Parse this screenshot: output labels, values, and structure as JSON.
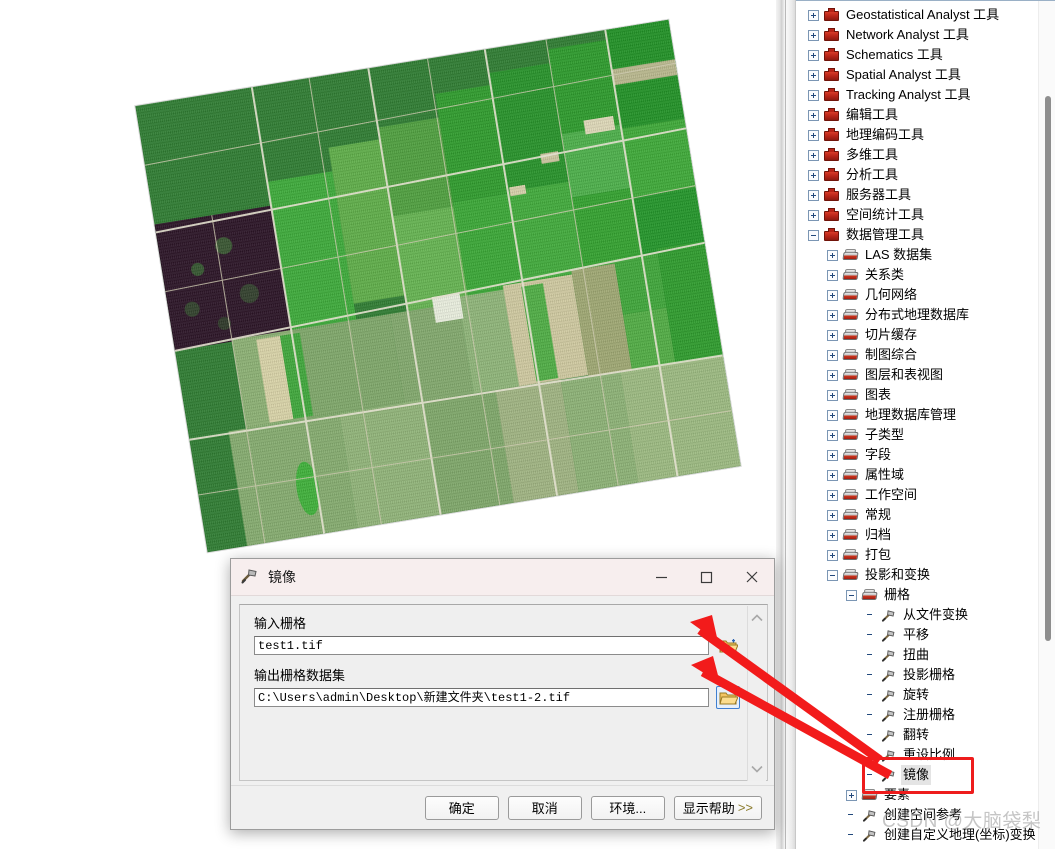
{
  "app": {
    "map_view_name": "data-view",
    "raster_description": "rotated aerial farmland raster"
  },
  "toolbox": {
    "panel_name": "ArcToolbox",
    "items": [
      {
        "label": "Geostatistical Analyst 工具",
        "level": 0,
        "icon": "toolbox-icon",
        "expander": "plus"
      },
      {
        "label": "Network Analyst 工具",
        "level": 0,
        "icon": "toolbox-icon",
        "expander": "plus"
      },
      {
        "label": "Schematics 工具",
        "level": 0,
        "icon": "toolbox-icon",
        "expander": "plus"
      },
      {
        "label": "Spatial Analyst 工具",
        "level": 0,
        "icon": "toolbox-icon",
        "expander": "plus"
      },
      {
        "label": "Tracking Analyst 工具",
        "level": 0,
        "icon": "toolbox-icon",
        "expander": "plus"
      },
      {
        "label": "编辑工具",
        "level": 0,
        "icon": "toolbox-icon",
        "expander": "plus"
      },
      {
        "label": "地理编码工具",
        "level": 0,
        "icon": "toolbox-icon",
        "expander": "plus"
      },
      {
        "label": "多维工具",
        "level": 0,
        "icon": "toolbox-icon",
        "expander": "plus"
      },
      {
        "label": "分析工具",
        "level": 0,
        "icon": "toolbox-icon",
        "expander": "plus"
      },
      {
        "label": "服务器工具",
        "level": 0,
        "icon": "toolbox-icon",
        "expander": "plus"
      },
      {
        "label": "空间统计工具",
        "level": 0,
        "icon": "toolbox-icon",
        "expander": "plus"
      },
      {
        "label": "数据管理工具",
        "level": 0,
        "icon": "toolbox-icon",
        "expander": "minus"
      },
      {
        "label": "LAS 数据集",
        "level": 1,
        "icon": "toolset-icon",
        "expander": "plus"
      },
      {
        "label": "关系类",
        "level": 1,
        "icon": "toolset-icon",
        "expander": "plus"
      },
      {
        "label": "几何网络",
        "level": 1,
        "icon": "toolset-icon",
        "expander": "plus"
      },
      {
        "label": "分布式地理数据库",
        "level": 1,
        "icon": "toolset-icon",
        "expander": "plus"
      },
      {
        "label": "切片缓存",
        "level": 1,
        "icon": "toolset-icon",
        "expander": "plus"
      },
      {
        "label": "制图综合",
        "level": 1,
        "icon": "toolset-icon",
        "expander": "plus"
      },
      {
        "label": "图层和表视图",
        "level": 1,
        "icon": "toolset-icon",
        "expander": "plus"
      },
      {
        "label": "图表",
        "level": 1,
        "icon": "toolset-icon",
        "expander": "plus"
      },
      {
        "label": "地理数据库管理",
        "level": 1,
        "icon": "toolset-icon",
        "expander": "plus"
      },
      {
        "label": "子类型",
        "level": 1,
        "icon": "toolset-icon",
        "expander": "plus"
      },
      {
        "label": "字段",
        "level": 1,
        "icon": "toolset-icon",
        "expander": "plus"
      },
      {
        "label": "属性域",
        "level": 1,
        "icon": "toolset-icon",
        "expander": "plus"
      },
      {
        "label": "工作空间",
        "level": 1,
        "icon": "toolset-icon",
        "expander": "plus"
      },
      {
        "label": "常规",
        "level": 1,
        "icon": "toolset-icon",
        "expander": "plus"
      },
      {
        "label": "归档",
        "level": 1,
        "icon": "toolset-icon",
        "expander": "plus"
      },
      {
        "label": "打包",
        "level": 1,
        "icon": "toolset-icon",
        "expander": "plus"
      },
      {
        "label": "投影和变换",
        "level": 1,
        "icon": "toolset-icon",
        "expander": "minus"
      },
      {
        "label": "栅格",
        "level": 2,
        "icon": "toolset-icon",
        "expander": "minus"
      },
      {
        "label": "从文件变换",
        "level": 3,
        "icon": "hammer-icon",
        "expander": "none"
      },
      {
        "label": "平移",
        "level": 3,
        "icon": "hammer-icon",
        "expander": "none"
      },
      {
        "label": "扭曲",
        "level": 3,
        "icon": "hammer-icon",
        "expander": "none"
      },
      {
        "label": "投影栅格",
        "level": 3,
        "icon": "hammer-icon",
        "expander": "none"
      },
      {
        "label": "旋转",
        "level": 3,
        "icon": "hammer-icon",
        "expander": "none"
      },
      {
        "label": "注册栅格",
        "level": 3,
        "icon": "hammer-icon",
        "expander": "none"
      },
      {
        "label": "翻转",
        "level": 3,
        "icon": "hammer-icon",
        "expander": "none"
      },
      {
        "label": "重设比例",
        "level": 3,
        "icon": "hammer-icon",
        "expander": "none"
      },
      {
        "label": "镜像",
        "level": 3,
        "icon": "hammer-icon",
        "expander": "none",
        "selected": true,
        "highlighted": true
      },
      {
        "label": "要素",
        "level": 2,
        "icon": "toolset-icon",
        "expander": "plus"
      },
      {
        "label": "创建空间参考",
        "level": 2,
        "icon": "hammer-icon",
        "expander": "none"
      },
      {
        "label": "创建自定义地理(坐标)变换",
        "level": 2,
        "icon": "hammer-icon",
        "expander": "none"
      }
    ]
  },
  "dialog": {
    "title": "镜像",
    "title_icon": "hammer-icon",
    "minimize_label": "–",
    "maximize_label": "□",
    "close_label": "✕",
    "fields": [
      {
        "label": "输入栅格",
        "value": "test1.tif",
        "name": "input-raster",
        "browse_icon": "folder-open-icon"
      },
      {
        "label": "输出栅格数据集",
        "value": "C:\\Users\\admin\\Desktop\\新建文件夹\\test1-2.tif",
        "name": "output-raster",
        "browse_icon": "folder-open-icon"
      }
    ],
    "buttons": [
      {
        "label": "确定",
        "name": "ok-button"
      },
      {
        "label": "取消",
        "name": "cancel-button"
      },
      {
        "label": "环境...",
        "name": "environments-button"
      },
      {
        "label": "显示帮助",
        "chevron": ">>",
        "name": "show-help-button"
      }
    ],
    "scroll_up_icon": "chevron-up-icon",
    "scroll_down_icon": "chevron-down-icon"
  },
  "annotations": {
    "highlight_color": "#ee1c1c",
    "arrow_color": "#f21b1b",
    "arrow_count": 2,
    "highlight_target": "镜像"
  },
  "watermark": {
    "text": "CSDN @大脑袋梨"
  },
  "colors": {
    "accent_red": "#ee1c1c",
    "toolbox_red": "#b52317",
    "dialog_title_bg": "#f7eeee",
    "panel_bg": "#f0f0f0"
  }
}
